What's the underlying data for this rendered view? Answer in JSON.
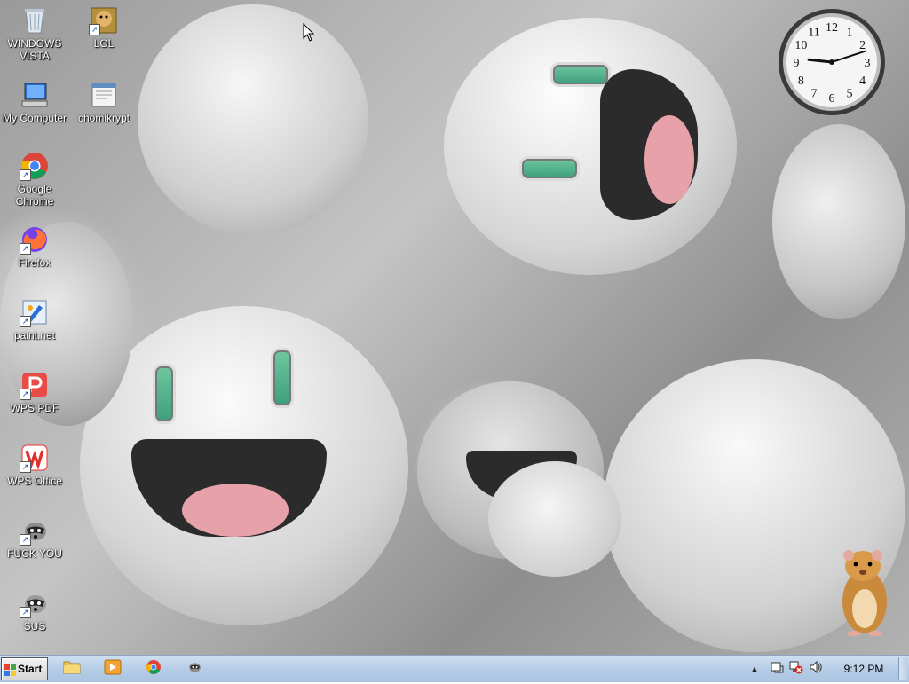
{
  "desktop_icons": [
    {
      "id": "recycle-bin",
      "label": "WINDOWS VISTA",
      "icon": "recycle-bin-icon"
    },
    {
      "id": "lol",
      "label": "LOL",
      "icon": "hamster-box-icon"
    },
    {
      "id": "my-computer",
      "label": "My Computer",
      "icon": "computer-icon"
    },
    {
      "id": "chomikrypt",
      "label": "chomikrypt",
      "icon": "document-window-icon"
    },
    {
      "id": "google-chrome",
      "label": "Google Chrome",
      "icon": "chrome-icon"
    },
    {
      "id": "firefox",
      "label": "Firefox",
      "icon": "firefox-icon"
    },
    {
      "id": "paint-net",
      "label": "paint.net",
      "icon": "paint-net-icon"
    },
    {
      "id": "wps-pdf",
      "label": "WPS PDF",
      "icon": "wps-pdf-icon"
    },
    {
      "id": "wps-office",
      "label": "WPS Office",
      "icon": "wps-office-icon"
    },
    {
      "id": "fuck-you",
      "label": "FUCK YOU",
      "icon": "raccoon-icon"
    },
    {
      "id": "sus",
      "label": "SUS",
      "icon": "raccoon-icon"
    }
  ],
  "taskbar": {
    "start_label": "Start",
    "pinned": [
      {
        "name": "explorer",
        "icon": "folder-icon"
      },
      {
        "name": "media-player",
        "icon": "media-player-icon"
      },
      {
        "name": "chrome",
        "icon": "chrome-icon"
      },
      {
        "name": "raccoon-app",
        "icon": "raccoon-icon"
      }
    ],
    "tray_icons": [
      "show-hidden-icons-arrow",
      "action-center-icon",
      "network-disconnected-icon",
      "volume-icon"
    ],
    "time": "9:12 PM"
  },
  "clock_gadget": {
    "numbers": [
      "12",
      "1",
      "2",
      "3",
      "4",
      "5",
      "6",
      "7",
      "8",
      "9",
      "10",
      "11"
    ],
    "hour": 9,
    "minute": 12
  },
  "colors": {
    "taskbar_top": "#cfe0f2",
    "taskbar_bottom": "#a9c3e0",
    "label_text": "#ffffff"
  }
}
